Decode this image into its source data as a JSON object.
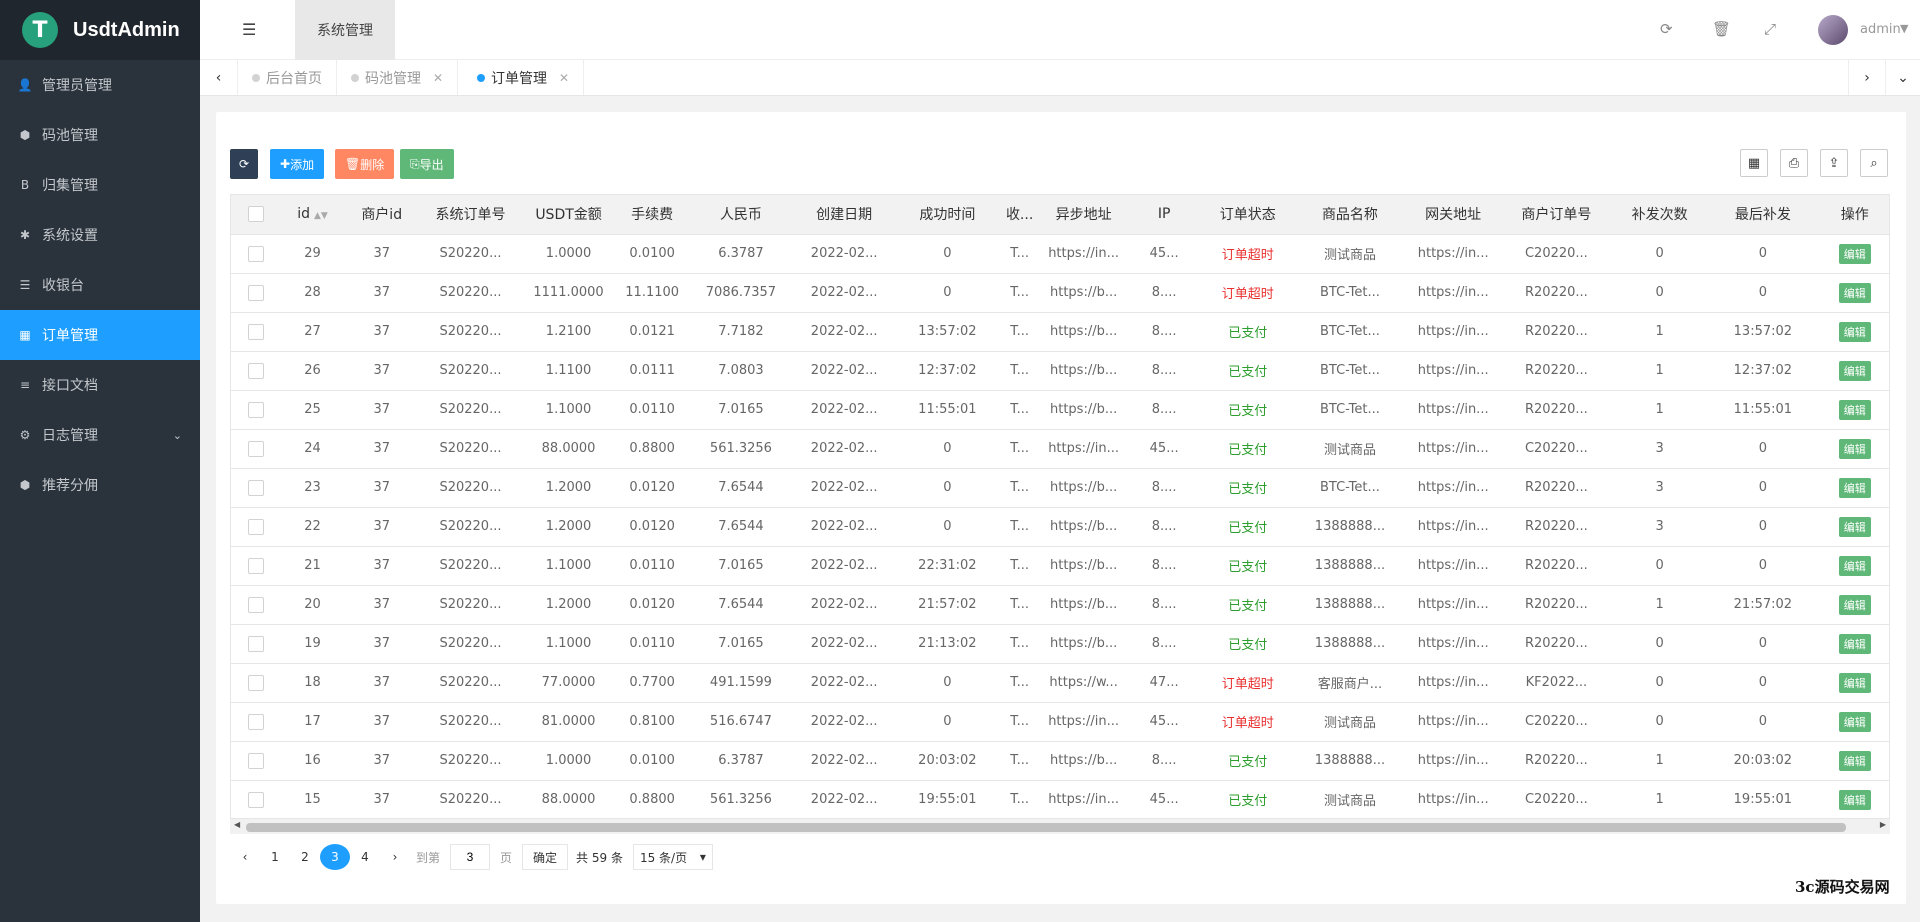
{
  "app": {
    "name": "UsdtAdmin",
    "logo_letter": "T",
    "brand_color": "#26a17b",
    "accent_color": "#1e9fff"
  },
  "sidebar": {
    "items": [
      {
        "label": "管理员管理",
        "icon": "user-icon",
        "glyph": "👤"
      },
      {
        "label": "码池管理",
        "icon": "android-icon",
        "glyph": "⬢"
      },
      {
        "label": "归集管理",
        "icon": "bitcoin-icon",
        "glyph": "B"
      },
      {
        "label": "系统设置",
        "icon": "asterisk-icon",
        "glyph": "✱"
      },
      {
        "label": "收银台",
        "icon": "list-icon",
        "glyph": "☰"
      },
      {
        "label": "订单管理",
        "icon": "calculator-icon",
        "glyph": "▦"
      },
      {
        "label": "接口文档",
        "icon": "align-left-icon",
        "glyph": "≡"
      },
      {
        "label": "日志管理",
        "icon": "gear-outline-icon",
        "glyph": "⚙"
      },
      {
        "label": "推荐分佣",
        "icon": "android-icon",
        "glyph": "⬢"
      }
    ]
  },
  "header": {
    "tab": "系统管理",
    "user": "admin"
  },
  "tabs": [
    {
      "label": "后台首页"
    },
    {
      "label": "码池管理"
    },
    {
      "label": "订单管理"
    }
  ],
  "toolbar": {
    "add": "添加",
    "delete": "删除",
    "export": "导出"
  },
  "table": {
    "columns": [
      "id",
      "商户id",
      "系统订单号",
      "USDT金额",
      "手续费",
      "人民币",
      "创建日期",
      "成功时间",
      "收...",
      "异步地址",
      "IP",
      "订单状态",
      "商品名称",
      "网关地址",
      "商户订单号",
      "补发次数",
      "最后补发",
      "操作"
    ],
    "edit_label": "编辑",
    "rows": [
      [
        "29",
        "37",
        "S20220...",
        "1.0000",
        "0.0100",
        "6.3787",
        "2022-02...",
        "0",
        "T...",
        "https://in...",
        "45...",
        "订单超时",
        "测试商品",
        "https://in...",
        "C20220...",
        "0",
        "0"
      ],
      [
        "28",
        "37",
        "S20220...",
        "1111.0000",
        "11.1100",
        "7086.7357",
        "2022-02...",
        "0",
        "T...",
        "https://b...",
        "8....",
        "订单超时",
        "BTC-Tet...",
        "https://in...",
        "R20220...",
        "0",
        "0"
      ],
      [
        "27",
        "37",
        "S20220...",
        "1.2100",
        "0.0121",
        "7.7182",
        "2022-02...",
        "13:57:02",
        "T...",
        "https://b...",
        "8....",
        "已支付",
        "BTC-Tet...",
        "https://in...",
        "R20220...",
        "1",
        "13:57:02"
      ],
      [
        "26",
        "37",
        "S20220...",
        "1.1100",
        "0.0111",
        "7.0803",
        "2022-02...",
        "12:37:02",
        "T...",
        "https://b...",
        "8....",
        "已支付",
        "BTC-Tet...",
        "https://in...",
        "R20220...",
        "1",
        "12:37:02"
      ],
      [
        "25",
        "37",
        "S20220...",
        "1.1000",
        "0.0110",
        "7.0165",
        "2022-02...",
        "11:55:01",
        "T...",
        "https://b...",
        "8....",
        "已支付",
        "BTC-Tet...",
        "https://in...",
        "R20220...",
        "1",
        "11:55:01"
      ],
      [
        "24",
        "37",
        "S20220...",
        "88.0000",
        "0.8800",
        "561.3256",
        "2022-02...",
        "0",
        "T...",
        "https://in...",
        "45...",
        "已支付",
        "测试商品",
        "https://in...",
        "C20220...",
        "3",
        "0"
      ],
      [
        "23",
        "37",
        "S20220...",
        "1.2000",
        "0.0120",
        "7.6544",
        "2022-02...",
        "0",
        "T...",
        "https://b...",
        "8....",
        "已支付",
        "BTC-Tet...",
        "https://in...",
        "R20220...",
        "3",
        "0"
      ],
      [
        "22",
        "37",
        "S20220...",
        "1.2000",
        "0.0120",
        "7.6544",
        "2022-02...",
        "0",
        "T...",
        "https://b...",
        "8....",
        "已支付",
        "1388888...",
        "https://in...",
        "R20220...",
        "3",
        "0"
      ],
      [
        "21",
        "37",
        "S20220...",
        "1.1000",
        "0.0110",
        "7.0165",
        "2022-02...",
        "22:31:02",
        "T...",
        "https://b...",
        "8....",
        "已支付",
        "1388888...",
        "https://in...",
        "R20220...",
        "0",
        "0"
      ],
      [
        "20",
        "37",
        "S20220...",
        "1.2000",
        "0.0120",
        "7.6544",
        "2022-02...",
        "21:57:02",
        "T...",
        "https://b...",
        "8....",
        "已支付",
        "1388888...",
        "https://in...",
        "R20220...",
        "1",
        "21:57:02"
      ],
      [
        "19",
        "37",
        "S20220...",
        "1.1000",
        "0.0110",
        "7.0165",
        "2022-02...",
        "21:13:02",
        "T...",
        "https://b...",
        "8....",
        "已支付",
        "1388888...",
        "https://in...",
        "R20220...",
        "0",
        "0"
      ],
      [
        "18",
        "37",
        "S20220...",
        "77.0000",
        "0.7700",
        "491.1599",
        "2022-02...",
        "0",
        "T...",
        "https://w...",
        "47...",
        "订单超时",
        "客服商户...",
        "https://in...",
        "KF2022...",
        "0",
        "0"
      ],
      [
        "17",
        "37",
        "S20220...",
        "81.0000",
        "0.8100",
        "516.6747",
        "2022-02...",
        "0",
        "T...",
        "https://in...",
        "45...",
        "订单超时",
        "测试商品",
        "https://in...",
        "C20220...",
        "0",
        "0"
      ],
      [
        "16",
        "37",
        "S20220...",
        "1.0000",
        "0.0100",
        "6.3787",
        "2022-02...",
        "20:03:02",
        "T...",
        "https://b...",
        "8....",
        "已支付",
        "1388888...",
        "https://in...",
        "R20220...",
        "1",
        "20:03:02"
      ],
      [
        "15",
        "37",
        "S20220...",
        "88.0000",
        "0.8800",
        "561.3256",
        "2022-02...",
        "19:55:01",
        "T...",
        "https://in...",
        "45...",
        "已支付",
        "测试商品",
        "https://in...",
        "C20220...",
        "1",
        "19:55:01"
      ]
    ]
  },
  "pager": {
    "pages": [
      "1",
      "2",
      "3",
      "4"
    ],
    "goto_label": "到第",
    "goto_value": "3",
    "page_unit": "页",
    "confirm": "确定",
    "total": "共 59 条",
    "per_page": "15 条/页"
  },
  "watermark": "3c源码交易网"
}
